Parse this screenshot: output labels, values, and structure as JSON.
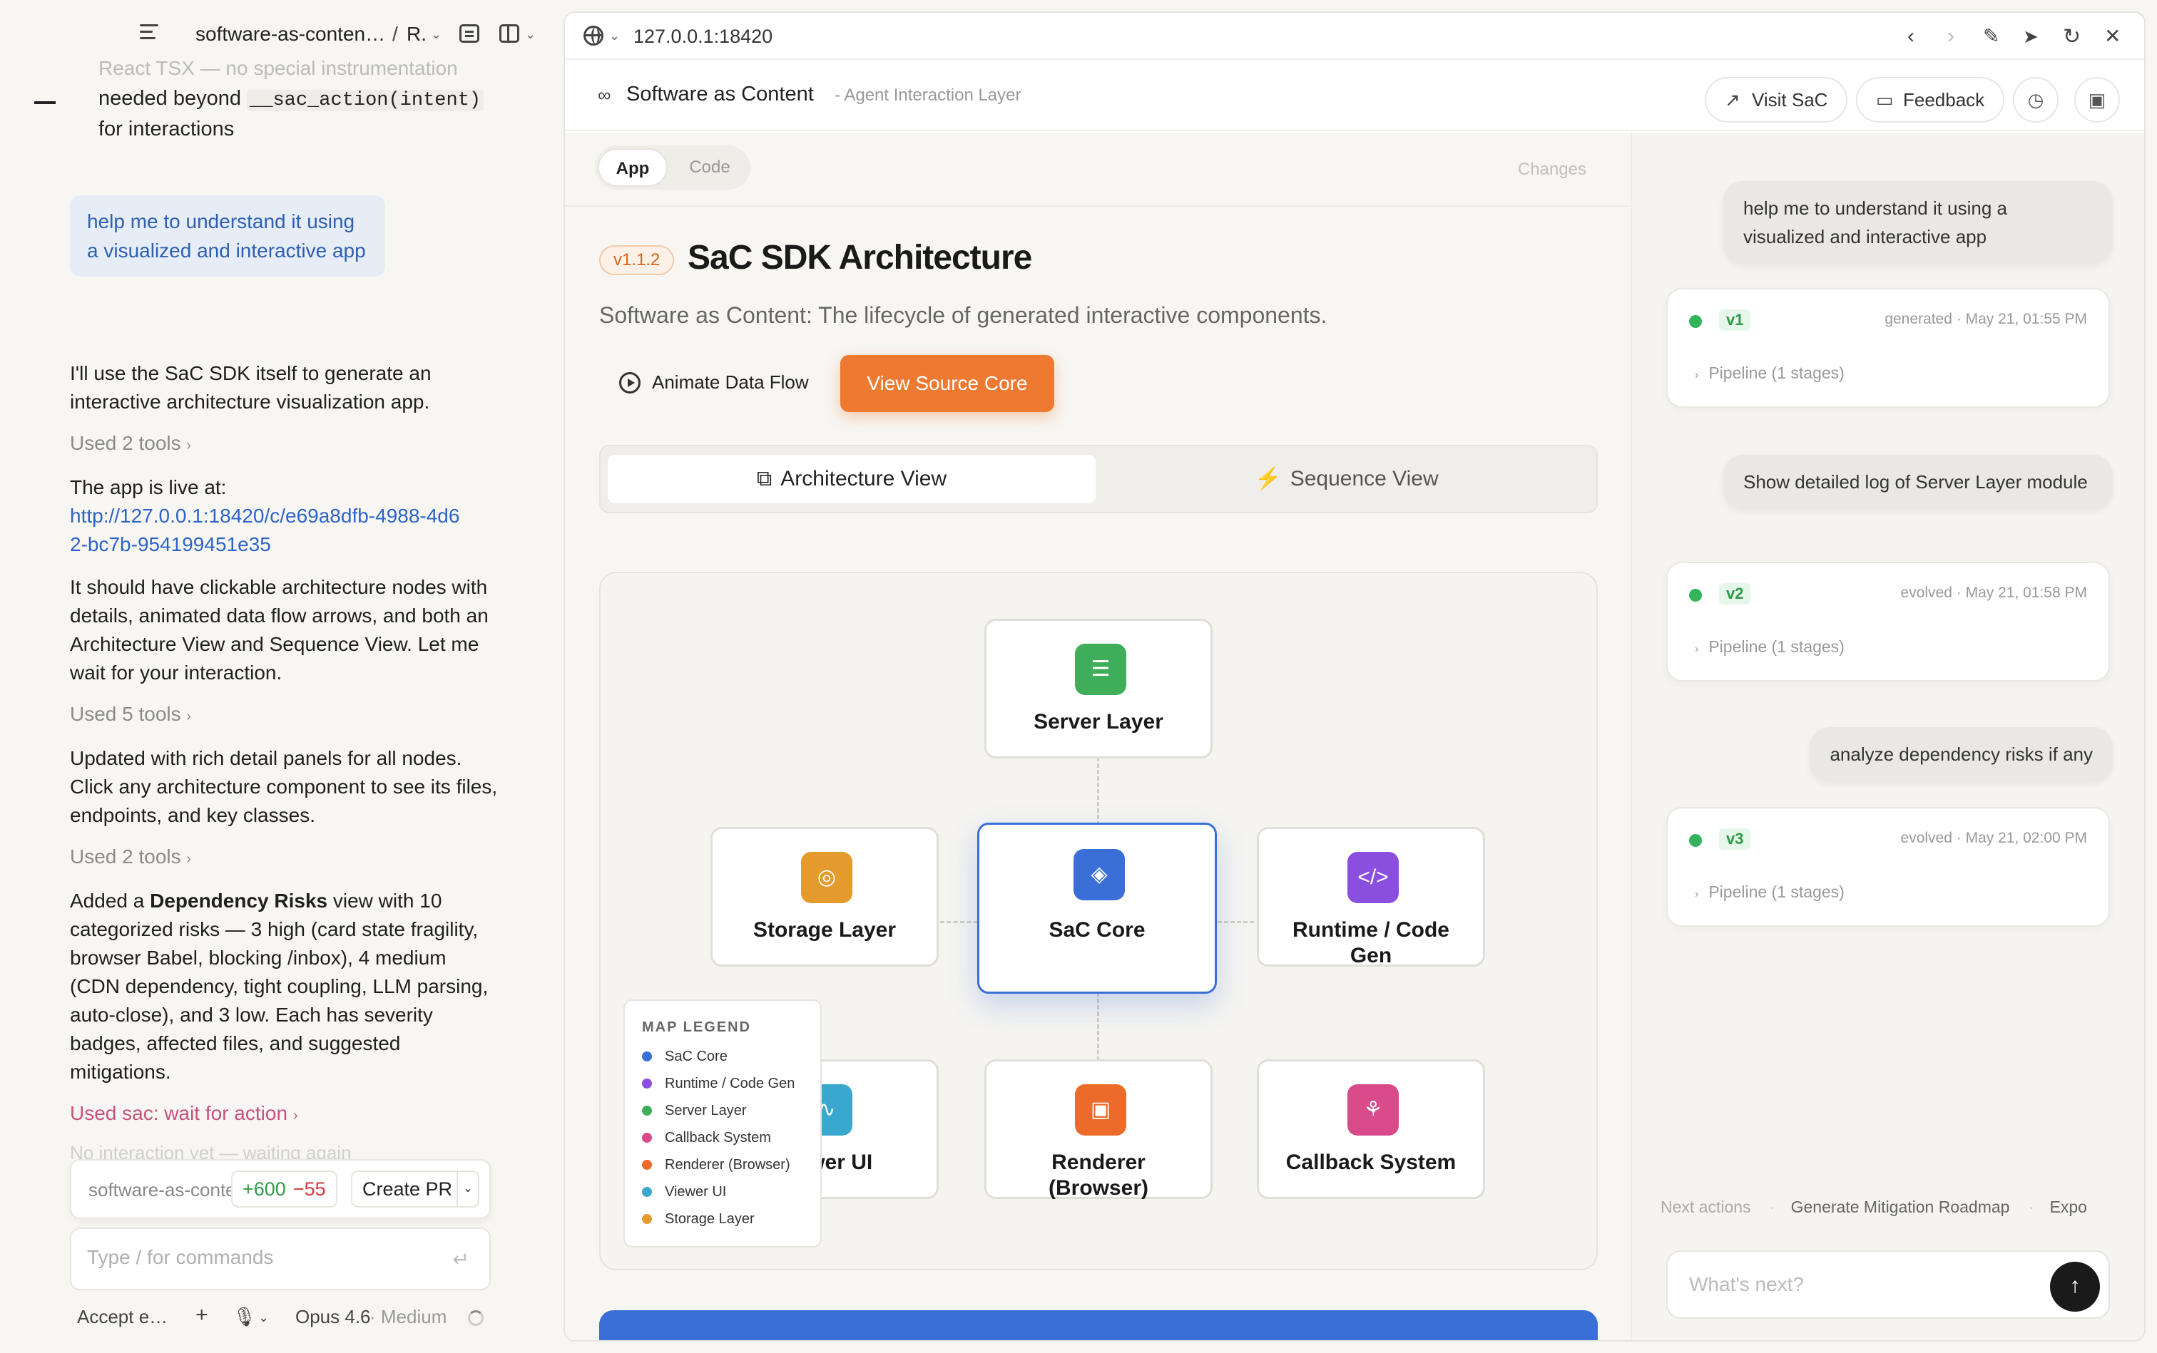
{
  "left": {
    "project_title": "software-as-conten…",
    "project_sep": "/",
    "branch": "R.",
    "faded_top": "React TSX — no special instrumentation",
    "msg_line1": "needed beyond",
    "msg_code": "__sac_action(intent)",
    "msg_line2": "for interactions",
    "user_bubble": "help me to understand it using a visualized and interactive app",
    "p1": "I'll use the SaC SDK itself to generate an interactive architecture visualization app.",
    "tools1": "Used 2 tools",
    "p2_prefix": "The app is live at:",
    "p2_link": "http://127.0.0.1:18420/c/e69a8dfb-4988-4d62-bc7b-954199451e35",
    "p3": "It should have clickable architecture nodes with details, animated data flow arrows, and both an Architecture View and Sequence View. Let me wait for your interaction.",
    "tools2": "Used 5 tools",
    "p4": "Updated with rich detail panels for all nodes. Click any architecture component to see its files, endpoints, and key classes.",
    "tools3": "Used 2 tools",
    "p5_a": "Added a ",
    "p5_b": "Dependency Risks",
    "p5_c": " view with 10 categorized risks — 3 high (card state fragility, browser Babel, blocking /inbox), 4 medium (CDN dependency, tight coupling, LLM parsing, auto-close), and 3 low. Each has severity badges, affected files, and suggested mitigations.",
    "tools4": "Used sac: wait for action",
    "faded_bottom": "No interaction yet — waiting again",
    "git": {
      "repo": "software-as-content",
      "plus": "+600",
      "minus": "−55",
      "pr_label": "Create PR"
    },
    "cmd_placeholder": "Type / for commands",
    "bottom": {
      "accept": "Accept e…",
      "model": "Opus 4.6",
      "effort": "· Medium"
    }
  },
  "browser": {
    "url": "127.0.0.1:18420",
    "app_name": "Software as Content",
    "app_sub": "- Agent Interaction Layer",
    "visit_label": "Visit SaC",
    "feedback_label": "Feedback"
  },
  "main": {
    "tab_app": "App",
    "tab_code": "Code",
    "changes": "Changes",
    "version": "v1.1.2",
    "title": "SaC SDK Architecture",
    "subtitle": "Software as Content: The lifecycle of generated interactive components.",
    "animate_label": "Animate Data Flow",
    "source_label": "View Source Core",
    "view_arch": "Architecture View",
    "view_seq": "Sequence View",
    "nodes": {
      "server": "Server Layer",
      "storage": "Storage Layer",
      "core": "SaC Core",
      "runtime": "Runtime / Code Gen",
      "viewer": "Viewer UI",
      "renderer": "Renderer (Browser)",
      "callback": "Callback System"
    },
    "legend": {
      "title": "MAP LEGEND",
      "items": [
        {
          "label": "SaC Core",
          "color": "#3b6fd8"
        },
        {
          "label": "Runtime / Code Gen",
          "color": "#8b4fe0"
        },
        {
          "label": "Server Layer",
          "color": "#3fae5a"
        },
        {
          "label": "Callback System",
          "color": "#d94a8a"
        },
        {
          "label": "Renderer (Browser)",
          "color": "#ec6a2a"
        },
        {
          "label": "Viewer UI",
          "color": "#3aa7cf"
        },
        {
          "label": "Storage Layer",
          "color": "#e59a2c"
        }
      ]
    }
  },
  "side": {
    "q1": "help me to understand it using a visualized and interactive app",
    "v1": {
      "tag": "v1",
      "meta": "generated · May 21, 01:55 PM",
      "pipe": "Pipeline (1 stages)"
    },
    "q2": "Show detailed log of Server Layer module",
    "v2": {
      "tag": "v2",
      "meta": "evolved · May 21, 01:58 PM",
      "pipe": "Pipeline (1 stages)"
    },
    "q3": "analyze dependency risks if any",
    "v3": {
      "tag": "v3",
      "meta": "evolved · May 21, 02:00 PM",
      "pipe": "Pipeline (1 stages)"
    },
    "next_label": "Next actions",
    "next1": "Generate Mitigation Roadmap",
    "next2": "Expo",
    "input_placeholder": "What's next?"
  }
}
